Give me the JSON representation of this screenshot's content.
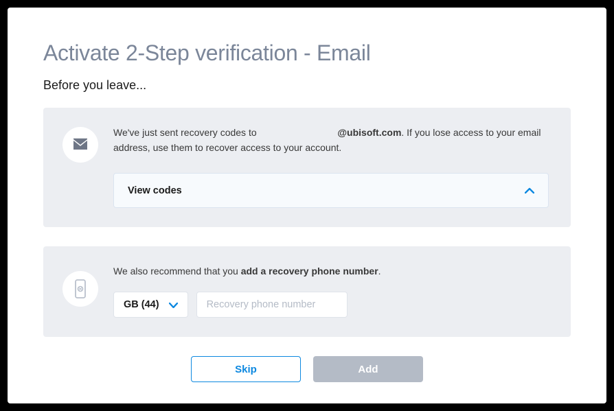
{
  "title": "Activate 2-Step verification - Email",
  "subtitle": "Before you leave...",
  "panel1": {
    "text_pre": "We've just sent recovery codes to ",
    "email_domain": "@ubisoft.com",
    "text_post": ". If you lose access to your email address, use them to recover access to your account.",
    "view_codes_label": "View codes"
  },
  "panel2": {
    "text_pre": "We also recommend that you ",
    "text_bold": "add a recovery phone number",
    "text_post": ".",
    "country_code_label": "GB (44)",
    "phone_placeholder": "Recovery phone number"
  },
  "buttons": {
    "skip": "Skip",
    "add": "Add"
  }
}
